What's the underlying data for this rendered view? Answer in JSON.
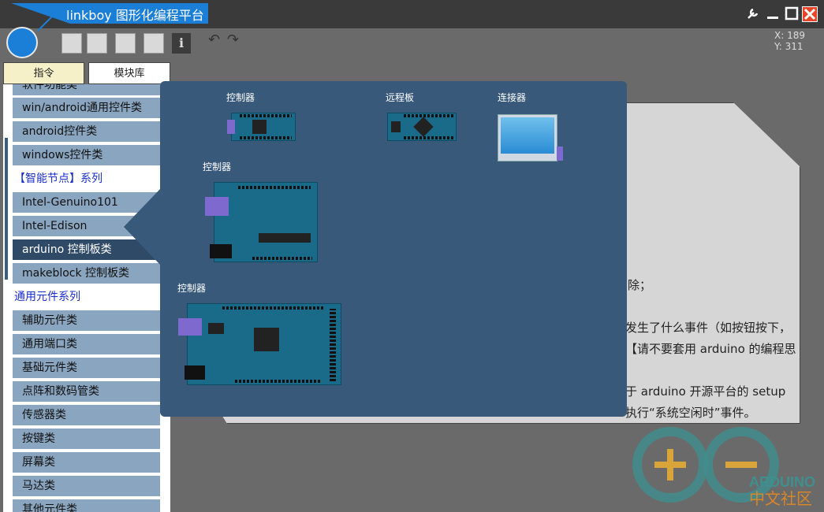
{
  "app": {
    "title": "linkboy 图形化编程平台"
  },
  "window": {
    "close_icon": "close-icon",
    "maximize_icon": "maximize-icon",
    "minimize_icon": "minimize-icon",
    "settings_icon": "wrench-icon"
  },
  "coordinates": {
    "x": "X: 189",
    "y": "Y: 311"
  },
  "tabs": [
    {
      "label": "指令"
    },
    {
      "label": "模块库"
    }
  ],
  "sidebar": {
    "items": [
      {
        "label": "软件功能类",
        "type": "item"
      },
      {
        "label": "win/android通用控件类",
        "type": "item"
      },
      {
        "label": "android控件类",
        "type": "item"
      },
      {
        "label": "windows控件类",
        "type": "item"
      },
      {
        "label": "【智能节点】系列",
        "type": "head"
      },
      {
        "label": "Intel-Genuino101",
        "type": "item"
      },
      {
        "label": "Intel-Edison",
        "type": "item"
      },
      {
        "label": "arduino 控制板类",
        "type": "active"
      },
      {
        "label": "makeblock 控制板类",
        "type": "item"
      },
      {
        "label": "通用元件系列",
        "type": "head"
      },
      {
        "label": "辅助元件类",
        "type": "item"
      },
      {
        "label": "通用端口类",
        "type": "item"
      },
      {
        "label": "基础元件类",
        "type": "item"
      },
      {
        "label": "点阵和数码管类",
        "type": "item"
      },
      {
        "label": "传感器类",
        "type": "item"
      },
      {
        "label": "按键类",
        "type": "item"
      },
      {
        "label": "屏幕类",
        "type": "item"
      },
      {
        "label": "马达类",
        "type": "item"
      },
      {
        "label": "其他元件类",
        "type": "item"
      }
    ]
  },
  "popup": {
    "items": [
      {
        "label": "控制器",
        "board": "arduino-nano"
      },
      {
        "label": "远程板",
        "board": "remote-board"
      },
      {
        "label": "连接器",
        "board": "connector"
      },
      {
        "label": "控制器",
        "board": "arduino-uno"
      },
      {
        "label": "控制器",
        "board": "arduino-mega"
      }
    ]
  },
  "document": {
    "lines": [
      "除；",
      "发生了什么事件（如按钮按下，",
      "【请不要套用 arduino 的编程思",
      "",
      "于 arduino 开源平台的 setup",
      "执行“系统空闲时”事件。"
    ]
  },
  "watermark": {
    "brand": "ARDUINO",
    "sub": "中文社区"
  },
  "colors": {
    "accent": "#1b7fd8",
    "sidebar_item": "#8aa5bf",
    "sidebar_active": "#2f4a66",
    "popup": "#38597a",
    "close": "#e8442a"
  }
}
